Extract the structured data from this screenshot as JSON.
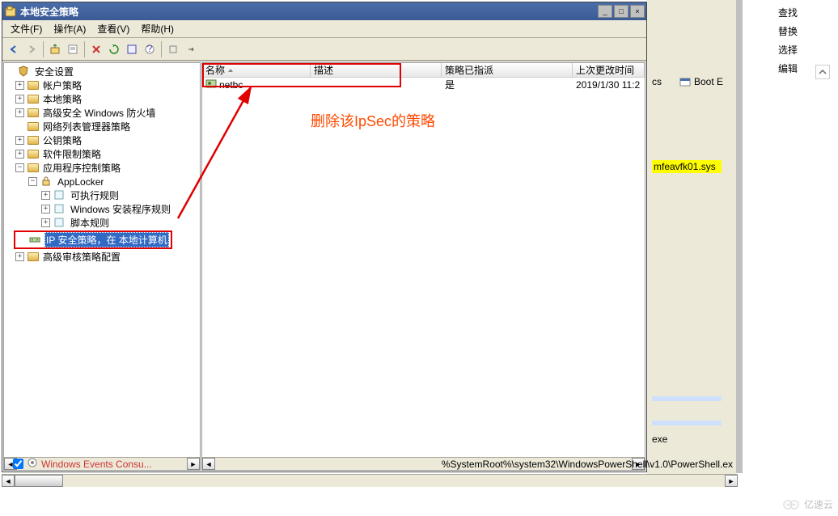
{
  "window": {
    "title": "本地安全策略",
    "min": "_",
    "max": "□",
    "close": "×"
  },
  "menu": {
    "file": "文件(F)",
    "action": "操作(A)",
    "view": "查看(V)",
    "help": "帮助(H)"
  },
  "tree": {
    "root": "安全设置",
    "account": "帐户策略",
    "local": "本地策略",
    "firewall": "高级安全 Windows 防火墙",
    "netlist": "网络列表管理器策略",
    "pubkey": "公钥策略",
    "softrestrict": "软件限制策略",
    "appcontrol": "应用程序控制策略",
    "applocker": "AppLocker",
    "exerules": "可执行规则",
    "installerRules": "Windows 安装程序规则",
    "scriptRules": "脚本规则",
    "ipsec": "IP 安全策略，在 本地计算机",
    "audit": "高级审核策略配置"
  },
  "list": {
    "col_name": "名称",
    "col_desc": "描述",
    "col_assigned": "策略已指派",
    "col_modified": "上次更改时间",
    "row_name": "netbc",
    "row_assigned": "是",
    "row_modified": "2019/1/30 11:2"
  },
  "annotation": "删除该IpSec的策略",
  "side": {
    "find": "查找",
    "replace": "替换",
    "select": "选择",
    "edit": "编辑",
    "boot": "Boot E",
    "cs": "cs",
    "sysfile": "mfeavfk01.sys",
    "exe": "exe"
  },
  "bottom": {
    "label": "Windows Events Consu...",
    "path": "%SystemRoot%\\system32\\WindowsPowerShell\\v1.0\\PowerShell.ex"
  },
  "watermark": "亿速云"
}
